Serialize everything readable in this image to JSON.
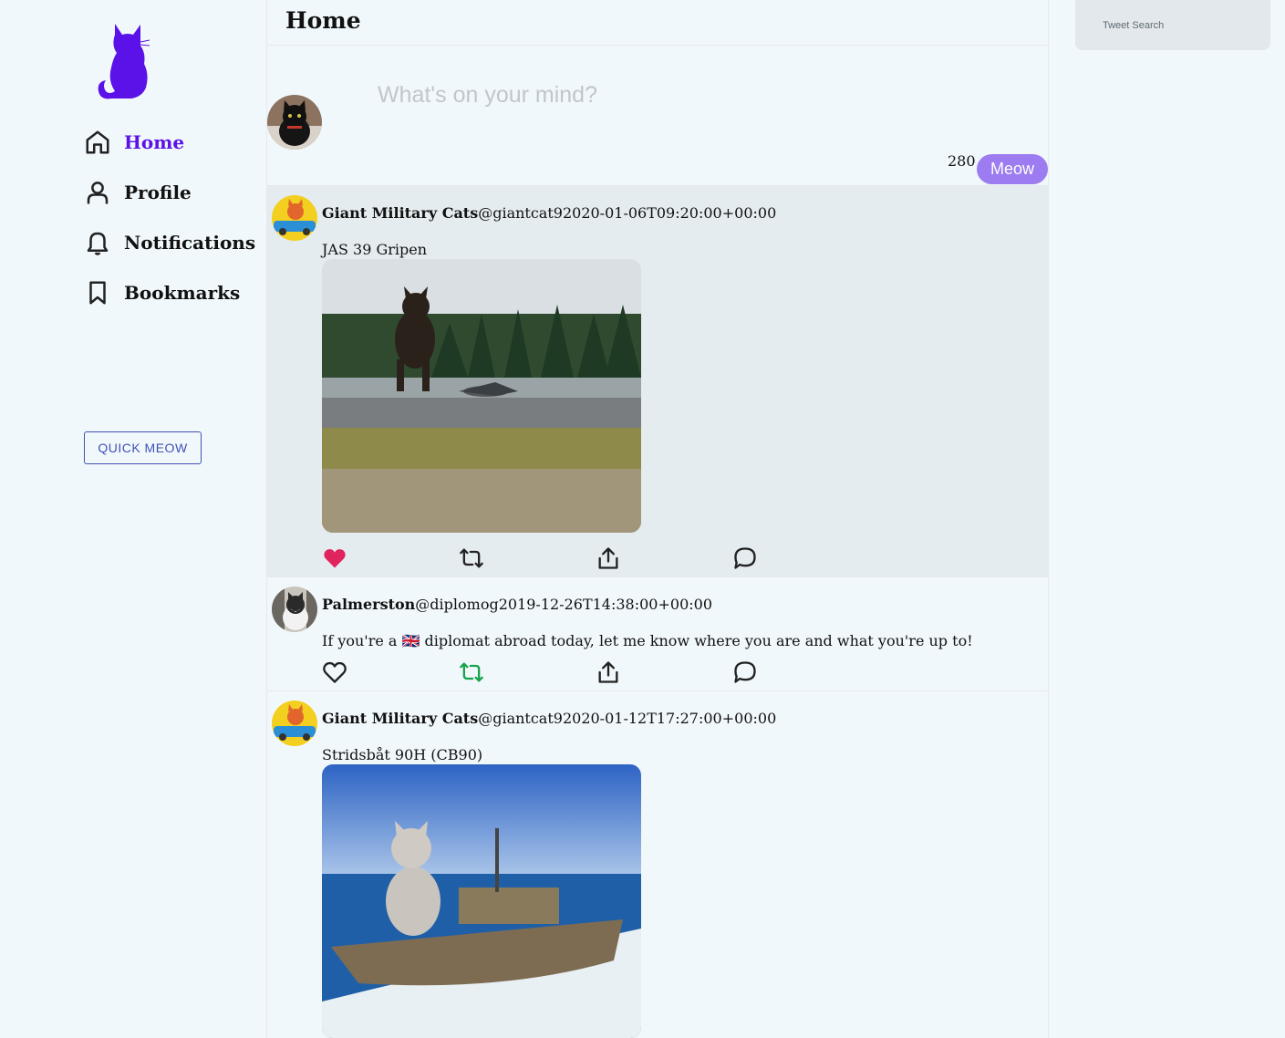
{
  "app": {
    "brand_color": "#5a12e8",
    "like_color": "#e0245e",
    "retweet_color": "#17a34a"
  },
  "sidebar": {
    "logo_icon": "cat-silhouette-icon",
    "items": [
      {
        "label": "Home",
        "icon": "home-icon",
        "active": true
      },
      {
        "label": "Profile",
        "icon": "user-icon",
        "active": false
      },
      {
        "label": "Notifications",
        "icon": "bell-icon",
        "active": false
      },
      {
        "label": "Bookmarks",
        "icon": "bookmark-icon",
        "active": false
      }
    ],
    "quick_button": "QUICK MEOW"
  },
  "main": {
    "title": "Home",
    "compose": {
      "placeholder": "What's on your mind?",
      "counter": "280",
      "submit_label": "Meow"
    },
    "tweets": [
      {
        "name": "Giant Military Cats",
        "handle": "@giantcat9",
        "timestamp": "2020-01-06T09:20:00+00:00",
        "text": "JAS 39 Gripen",
        "media": "cat-and-jet-photo",
        "liked": true,
        "retweeted": false
      },
      {
        "name": "Palmerston",
        "handle": "@diplomog",
        "timestamp": "2019-12-26T14:38:00+00:00",
        "text": "If you're a 🇬🇧 diplomat abroad today, let me know where you are and what you're up to!",
        "media": null,
        "liked": false,
        "retweeted": true
      },
      {
        "name": "Giant Military Cats",
        "handle": "@giantcat9",
        "timestamp": "2020-01-12T17:27:00+00:00",
        "text": "Stridsbåt 90H (CB90)",
        "media": "cat-on-boat-photo",
        "liked": false,
        "retweeted": false
      }
    ]
  },
  "search": {
    "placeholder": "Tweet Search"
  }
}
